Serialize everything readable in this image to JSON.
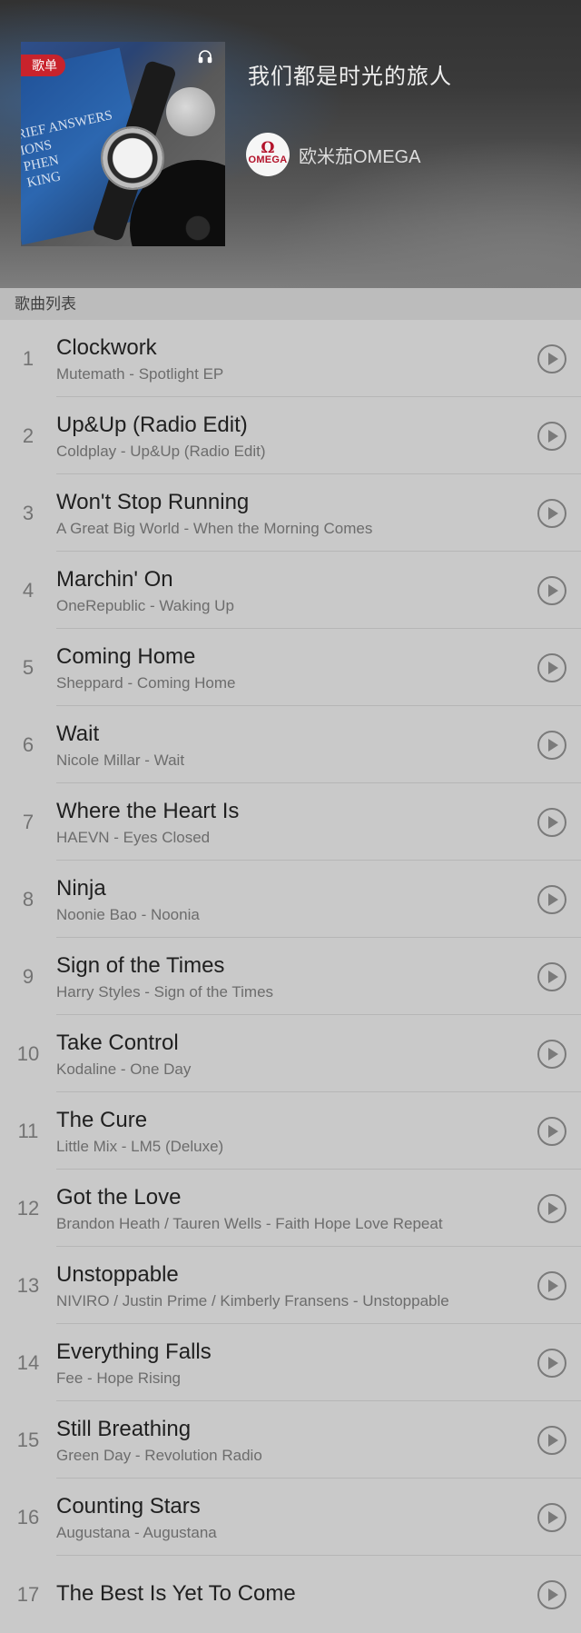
{
  "playlist": {
    "badge": "歌单",
    "title": "我们都是时光的旅人",
    "creator": {
      "name": "欧米茄OMEGA",
      "logo_symbol": "Ω",
      "logo_word": "OMEGA"
    },
    "cover_text": [
      "RIEF ANSWERS",
      "IONS",
      "PHEN",
      "KING"
    ]
  },
  "section_label": "歌曲列表",
  "colors": {
    "badge": "#c8232c",
    "logo": "#b3132b"
  },
  "songs": [
    {
      "index": "1",
      "title": "Clockwork",
      "subtitle": "Mutemath - Spotlight EP"
    },
    {
      "index": "2",
      "title": "Up&Up (Radio Edit)",
      "subtitle": "Coldplay - Up&Up (Radio Edit)"
    },
    {
      "index": "3",
      "title": "Won't Stop Running",
      "subtitle": "A Great Big World - When the Morning Comes"
    },
    {
      "index": "4",
      "title": "Marchin' On",
      "subtitle": "OneRepublic - Waking Up"
    },
    {
      "index": "5",
      "title": "Coming Home",
      "subtitle": "Sheppard - Coming Home"
    },
    {
      "index": "6",
      "title": "Wait",
      "subtitle": "Nicole Millar - Wait"
    },
    {
      "index": "7",
      "title": "Where the Heart Is",
      "subtitle": "HAEVN - Eyes Closed"
    },
    {
      "index": "8",
      "title": "Ninja",
      "subtitle": "Noonie Bao - Noonia"
    },
    {
      "index": "9",
      "title": "Sign of the Times",
      "subtitle": "Harry Styles - Sign of the Times"
    },
    {
      "index": "10",
      "title": "Take Control",
      "subtitle": "Kodaline - One Day"
    },
    {
      "index": "11",
      "title": "The Cure",
      "subtitle": "Little Mix - LM5 (Deluxe)"
    },
    {
      "index": "12",
      "title": "Got the Love",
      "subtitle": "Brandon Heath / Tauren Wells - Faith Hope Love Repeat"
    },
    {
      "index": "13",
      "title": "Unstoppable",
      "subtitle": "NIVIRO / Justin Prime / Kimberly Fransens - Unstoppable"
    },
    {
      "index": "14",
      "title": "Everything Falls",
      "subtitle": "Fee - Hope Rising"
    },
    {
      "index": "15",
      "title": "Still Breathing",
      "subtitle": "Green Day - Revolution Radio"
    },
    {
      "index": "16",
      "title": "Counting Stars",
      "subtitle": "Augustana - Augustana"
    },
    {
      "index": "17",
      "title": "The Best Is Yet To Come",
      "subtitle": ""
    }
  ]
}
